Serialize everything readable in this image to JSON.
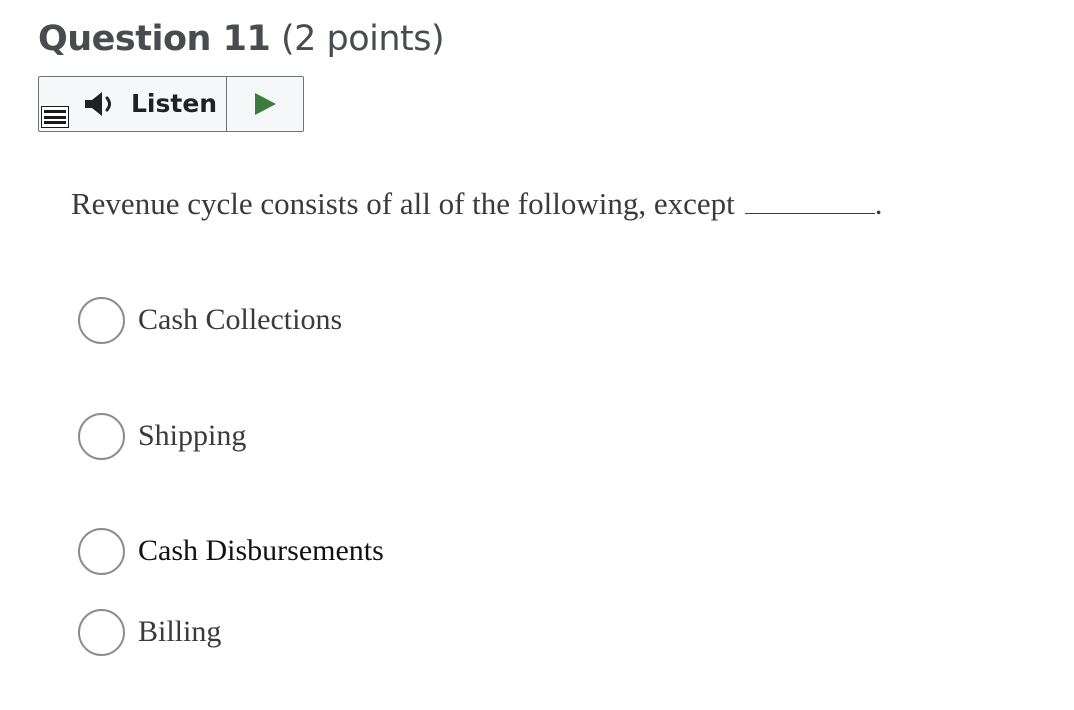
{
  "question": {
    "title": "Question 11",
    "points": "(2 points)"
  },
  "listen": {
    "label": "Listen"
  },
  "prompt": {
    "text": "Revenue cycle consists of all of the following, except",
    "end": "."
  },
  "options": [
    {
      "label": "Cash Collections"
    },
    {
      "label": "Shipping"
    },
    {
      "label": "Cash Disbursements"
    },
    {
      "label": "Billing"
    }
  ],
  "colors": {
    "play_green": "#3c7d3f",
    "header_text": "#494c4e",
    "radio_border": "#8a8c8e"
  }
}
